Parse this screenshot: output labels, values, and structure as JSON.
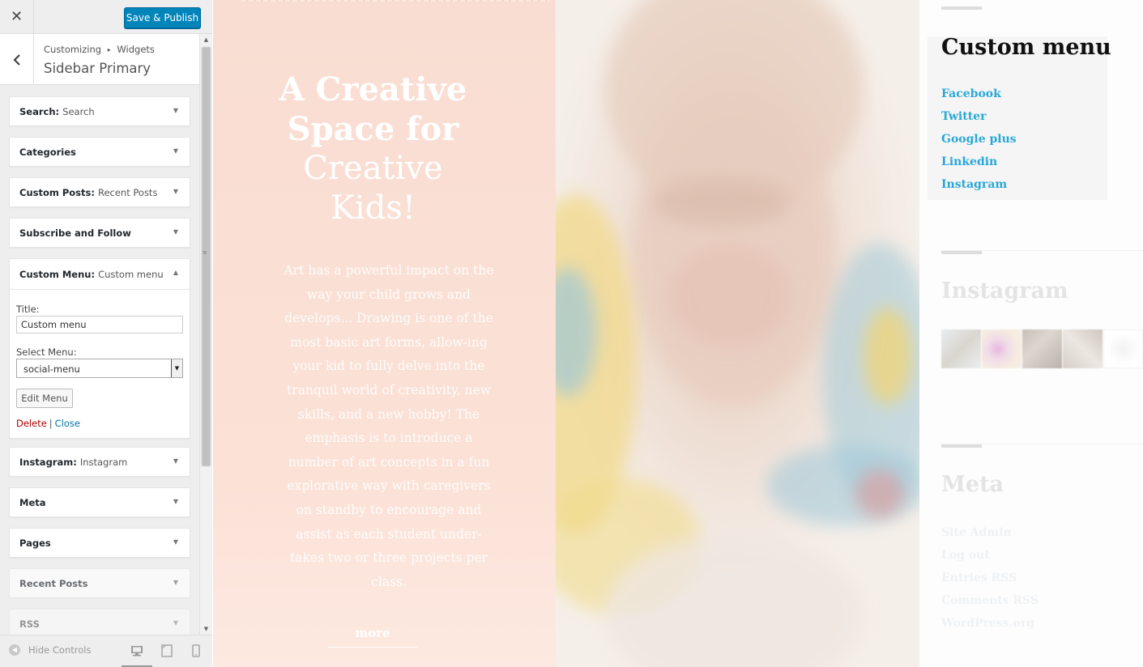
{
  "customizer": {
    "close_icon": "✕",
    "publish_label": "Save & Publish",
    "breadcrumb": {
      "root": "Customizing",
      "separator": "▸",
      "child": "Widgets"
    },
    "section_title": "Sidebar Primary",
    "widgets": [
      {
        "title": "Search",
        "instance": "Search",
        "expanded": false
      },
      {
        "title": "Categories",
        "instance": "",
        "expanded": false
      },
      {
        "title": "Custom Posts",
        "instance": "Recent Posts",
        "expanded": false
      },
      {
        "title": "Subscribe and Follow",
        "instance": "",
        "expanded": false
      },
      {
        "title": "Custom Menu",
        "instance": "Custom menu",
        "expanded": true
      },
      {
        "title": "Instagram",
        "instance": "Instagram",
        "expanded": false
      },
      {
        "title": "Meta",
        "instance": "",
        "expanded": false
      },
      {
        "title": "Pages",
        "instance": "",
        "expanded": false
      },
      {
        "title": "Recent Posts",
        "instance": "",
        "expanded": false
      },
      {
        "title": "RSS",
        "instance": "",
        "expanded": false
      }
    ],
    "custom_menu_form": {
      "title_label": "Title:",
      "title_value": "Custom menu",
      "menu_label": "Select Menu:",
      "menu_value": "social-menu",
      "edit_button": "Edit Menu",
      "delete_link": "Delete",
      "link_separator": "|",
      "close_link": "Close"
    },
    "footer": {
      "hide_controls": "Hide Controls",
      "active_device": "desktop"
    }
  },
  "preview": {
    "hero": {
      "title_bold": "A Creative Space for",
      "title_light": "Creative Kids!",
      "text": "Art has a powerful impact on the way your child grows and develops... Drawing is one of the most basic art forms, allow-ing your kid to fully delve into the tranquil world of creativity, new skills, and a new hobby! The emphasis is to introduce a number of art concepts in a fun explorative way with caregivers on standby to encourage and assist as each student under-takes two or three projects per class.",
      "more": "more"
    },
    "sidebar": {
      "custom_menu": {
        "title": "Custom menu",
        "links": [
          "Facebook",
          "Twitter",
          "Google plus",
          "Linkedin",
          "Instagram"
        ]
      },
      "instagram": {
        "title": "Instagram"
      },
      "meta": {
        "title": "Meta",
        "links": [
          "Site Admin",
          "Log out",
          "Entries RSS",
          "Comments RSS",
          "WordPress.org"
        ]
      }
    }
  },
  "colors": {
    "publish_blue": "#0085ba",
    "link_blue": "#29a8d6",
    "hero_pink": "#f9ddd2",
    "delete_red": "#aa0000"
  }
}
